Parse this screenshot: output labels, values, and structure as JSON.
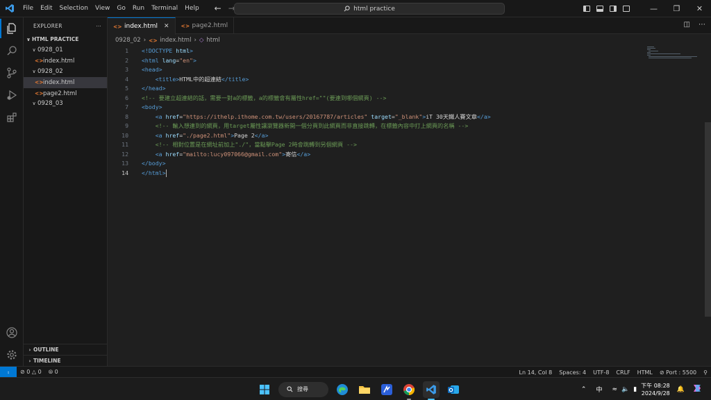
{
  "menu": [
    "File",
    "Edit",
    "Selection",
    "View",
    "Go",
    "Run",
    "Terminal",
    "Help"
  ],
  "command_center": "html practice",
  "explorer": {
    "title": "EXPLORER",
    "root": "HTML PRACTICE",
    "items": [
      {
        "label": "0928_01",
        "type": "folder"
      },
      {
        "label": "index.html",
        "type": "file"
      },
      {
        "label": "0928_02",
        "type": "folder"
      },
      {
        "label": "index.html",
        "type": "file",
        "selected": true
      },
      {
        "label": "page2.html",
        "type": "file"
      },
      {
        "label": "0928_03",
        "type": "folder"
      }
    ],
    "outline": "OUTLINE",
    "timeline": "TIMELINE"
  },
  "tabs": [
    {
      "label": "index.html",
      "active": true
    },
    {
      "label": "page2.html",
      "active": false
    }
  ],
  "breadcrumb": {
    "folder": "0928_02",
    "file": "index.html",
    "symbol": "html"
  },
  "code_lines": [
    [
      [
        "tag",
        "<!DOCTYPE "
      ],
      [
        "attr",
        "html"
      ],
      [
        "tag",
        ">"
      ]
    ],
    [
      [
        "tag",
        "<html "
      ],
      [
        "attr",
        "lang"
      ],
      [
        "text",
        "="
      ],
      [
        "str",
        "\"en\""
      ],
      [
        "tag",
        ">"
      ]
    ],
    [
      [
        "tag",
        "<head>"
      ]
    ],
    [
      [
        "text",
        "    "
      ],
      [
        "tag",
        "<title>"
      ],
      [
        "text",
        "HTML中的超連結"
      ],
      [
        "tag",
        "</title>"
      ]
    ],
    [
      [
        "tag",
        "</head>"
      ]
    ],
    [
      [
        "com",
        "<!-- 要建立超連結的話，需要一對a的標籤，a的標籤會有屬性href=\"\"(要連到哪個網頁) -->"
      ]
    ],
    [
      [
        "tag",
        "<body>"
      ]
    ],
    [
      [
        "text",
        "    "
      ],
      [
        "tag",
        "<a "
      ],
      [
        "attr",
        "href"
      ],
      [
        "text",
        "="
      ],
      [
        "str",
        "\"https://ithelp.ithome.com.tw/users/20167787/articles\""
      ],
      [
        "text",
        " "
      ],
      [
        "attr",
        "target"
      ],
      [
        "text",
        "="
      ],
      [
        "str",
        "\"_blank\""
      ],
      [
        "tag",
        ">"
      ],
      [
        "text",
        "iT 30天鐵人賽文章"
      ],
      [
        "tag",
        "</a>"
      ]
    ],
    [
      [
        "text",
        "    "
      ],
      [
        "com",
        "<!-- 輸入想連到的網頁，用target屬性讓瀏覽器新開一個分頁到此網頁而非直接跳轉，在標籤內容中打上網頁的名稱 -->"
      ]
    ],
    [
      [
        "text",
        "    "
      ],
      [
        "tag",
        "<a "
      ],
      [
        "attr",
        "href"
      ],
      [
        "text",
        "="
      ],
      [
        "str",
        "\"./page2.html\""
      ],
      [
        "tag",
        ">"
      ],
      [
        "text",
        "Page 2"
      ],
      [
        "tag",
        "</a>"
      ]
    ],
    [
      [
        "text",
        "    "
      ],
      [
        "com",
        "<!-- 相對位置是在網址前加上\"./\"，當點擊Page 2時會跳轉到另個網頁 -->"
      ]
    ],
    [
      [
        "text",
        "    "
      ],
      [
        "tag",
        "<a "
      ],
      [
        "attr",
        "href"
      ],
      [
        "text",
        "="
      ],
      [
        "str",
        "\"mailto:lucy097066@gmail.com\""
      ],
      [
        "tag",
        ">"
      ],
      [
        "text",
        "寄信"
      ],
      [
        "tag",
        "</a>"
      ]
    ],
    [
      [
        "tag",
        "</body>"
      ]
    ],
    [
      [
        "tag",
        "</html>"
      ]
    ]
  ],
  "current_line": 14,
  "status": {
    "errors": "0",
    "warnings": "0",
    "ports": "0",
    "position": "Ln 14, Col 8",
    "spaces": "Spaces: 4",
    "encoding": "UTF-8",
    "eol": "CRLF",
    "language": "HTML",
    "port": "Port : 5500"
  },
  "taskbar": {
    "search": "搜尋",
    "ime": "中",
    "time": "下午 08:28",
    "date": "2024/9/28"
  }
}
